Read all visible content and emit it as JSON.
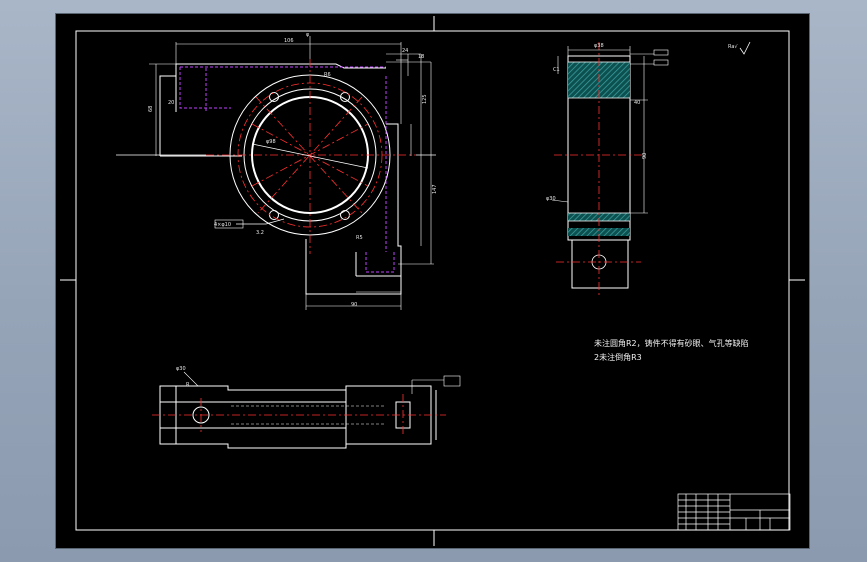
{
  "drawing": {
    "notes": {
      "line1": "未注圆角R2，铸件不得有砂眼、气孔等缺陷",
      "line2": "2未注倒角R3"
    },
    "surface_mark": "Ra√"
  },
  "colors": {
    "background": "#000000",
    "outline": "#ffffff",
    "centerline": "#ff3030",
    "hidden": "#c040ff",
    "section": "#2a8a8a"
  }
}
